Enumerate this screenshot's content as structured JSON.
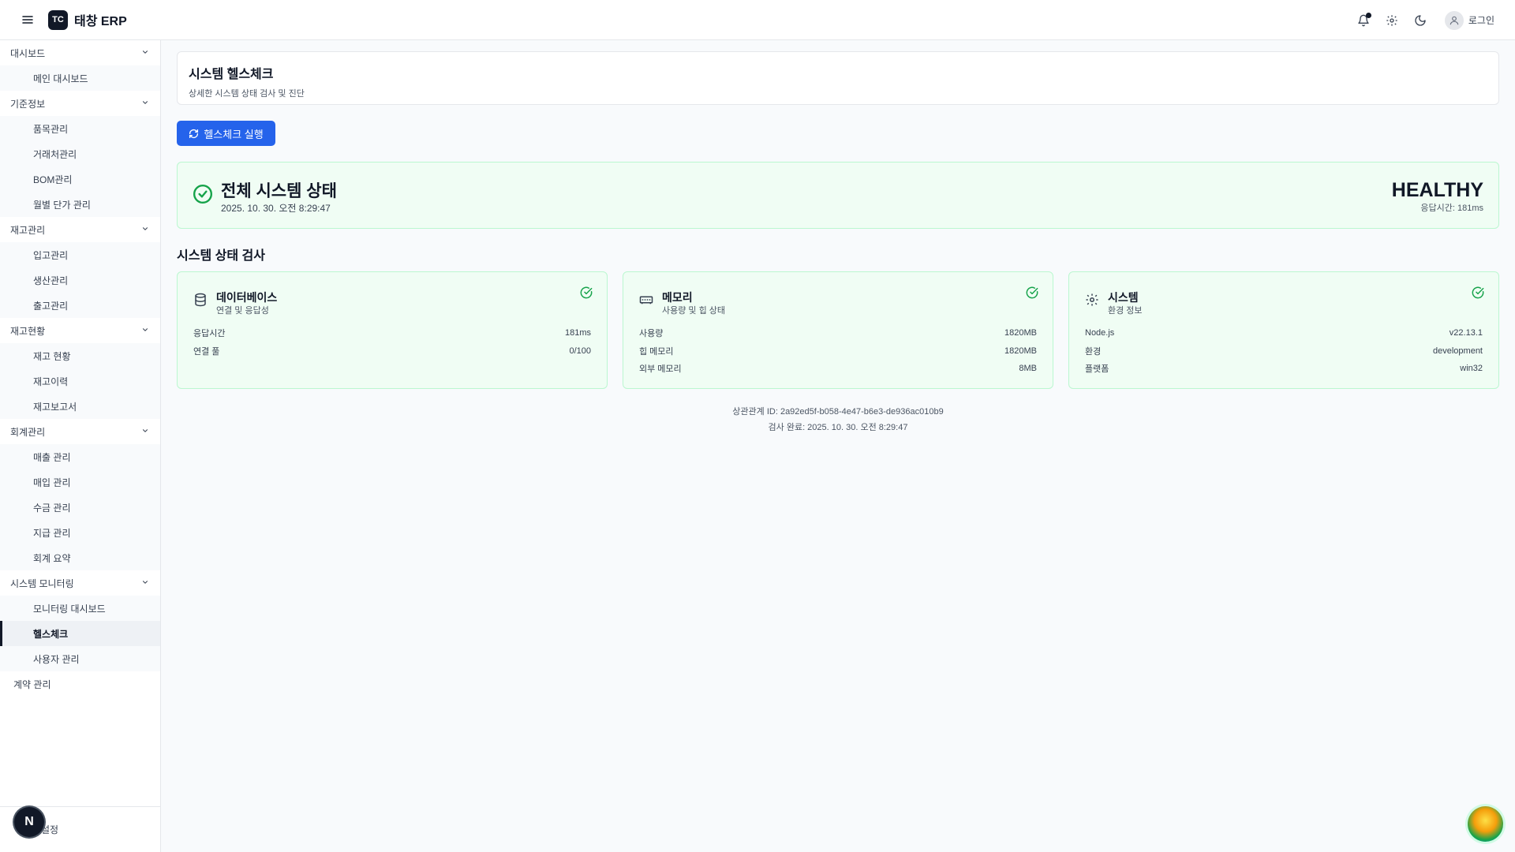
{
  "app": {
    "logo_badge": "TC",
    "title": "태창 ERP"
  },
  "header": {
    "login_label": "로그인"
  },
  "sidebar": {
    "sections": [
      {
        "label": "대시보드",
        "items": [
          "메인 대시보드"
        ]
      },
      {
        "label": "기준정보",
        "items": [
          "품목관리",
          "거래처관리",
          "BOM관리",
          "월별 단가 관리"
        ]
      },
      {
        "label": "재고관리",
        "items": [
          "입고관리",
          "생산관리",
          "출고관리"
        ]
      },
      {
        "label": "재고현황",
        "items": [
          "재고 현황",
          "재고이력",
          "재고보고서"
        ]
      },
      {
        "label": "회계관리",
        "items": [
          "매출 관리",
          "매입 관리",
          "수금 관리",
          "지급 관리",
          "회계 요약"
        ]
      },
      {
        "label": "시스템 모니터링",
        "items": [
          "모니터링 대시보드",
          "헬스체크",
          "사용자 관리"
        ]
      }
    ],
    "single_item": "계약 관리",
    "footer_label": "설정",
    "next_badge": "N"
  },
  "page": {
    "title": "시스템 헬스체크",
    "subtitle": "상세한 시스템 상태 검사 및 진단",
    "run_button": "헬스체크 실행"
  },
  "overall": {
    "title": "전체 시스템 상태",
    "timestamp": "2025. 10. 30. 오전 8:29:47",
    "status": "HEALTHY",
    "response": "응답시간: 181ms"
  },
  "checks": {
    "section_title": "시스템 상태 검사",
    "cards": [
      {
        "name": "데이터베이스",
        "desc": "연결 및 응답성",
        "icon": "database-icon",
        "rows": [
          {
            "k": "응답시간",
            "v": "181ms"
          },
          {
            "k": "연결 풀",
            "v": "0/100"
          }
        ]
      },
      {
        "name": "메모리",
        "desc": "사용량 및 힙 상태",
        "icon": "memory-icon",
        "rows": [
          {
            "k": "사용량",
            "v": "1820MB"
          },
          {
            "k": "힙 메모리",
            "v": "1820MB"
          },
          {
            "k": "외부 메모리",
            "v": "8MB"
          }
        ]
      },
      {
        "name": "시스템",
        "desc": "환경 정보",
        "icon": "gear-icon",
        "rows": [
          {
            "k": "Node.js",
            "v": "v22.13.1"
          },
          {
            "k": "환경",
            "v": "development"
          },
          {
            "k": "플랫폼",
            "v": "win32"
          }
        ]
      }
    ]
  },
  "footer": {
    "correlation": "상관관계 ID: 2a92ed5f-b058-4e47-b6e3-de936ac010b9",
    "completed": "검사 완료: 2025. 10. 30. 오전 8:29:47"
  },
  "colors": {
    "accent": "#2563eb",
    "success": "#16a34a",
    "success_bg": "#f0fdf4"
  }
}
